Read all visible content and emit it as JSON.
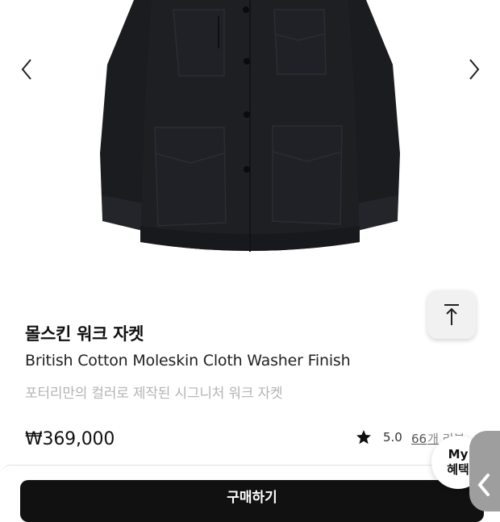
{
  "product": {
    "title": "몰스킨 워크 자켓",
    "subtitle": "British Cotton Moleskin Cloth Washer Finish",
    "description": "포터리만의 컬러로 제작된 시그니처 워크 자켓",
    "price": "₩369,000",
    "rating": "5.0",
    "review_count": "66",
    "review_label": "개 리뷰"
  },
  "gallery": {
    "prev_icon": "chevron-left-icon",
    "next_icon": "chevron-right-icon",
    "image": "black-moleskin-work-jacket"
  },
  "actions": {
    "scroll_top_icon": "arrow-up-to-top-icon",
    "buy_label": "구매하기",
    "benefit_line1": "My",
    "benefit_line2": "혜택"
  },
  "colors": {
    "jacket": "#1c1d21",
    "button": "#111111",
    "side_tab": "#9e9e9e"
  }
}
